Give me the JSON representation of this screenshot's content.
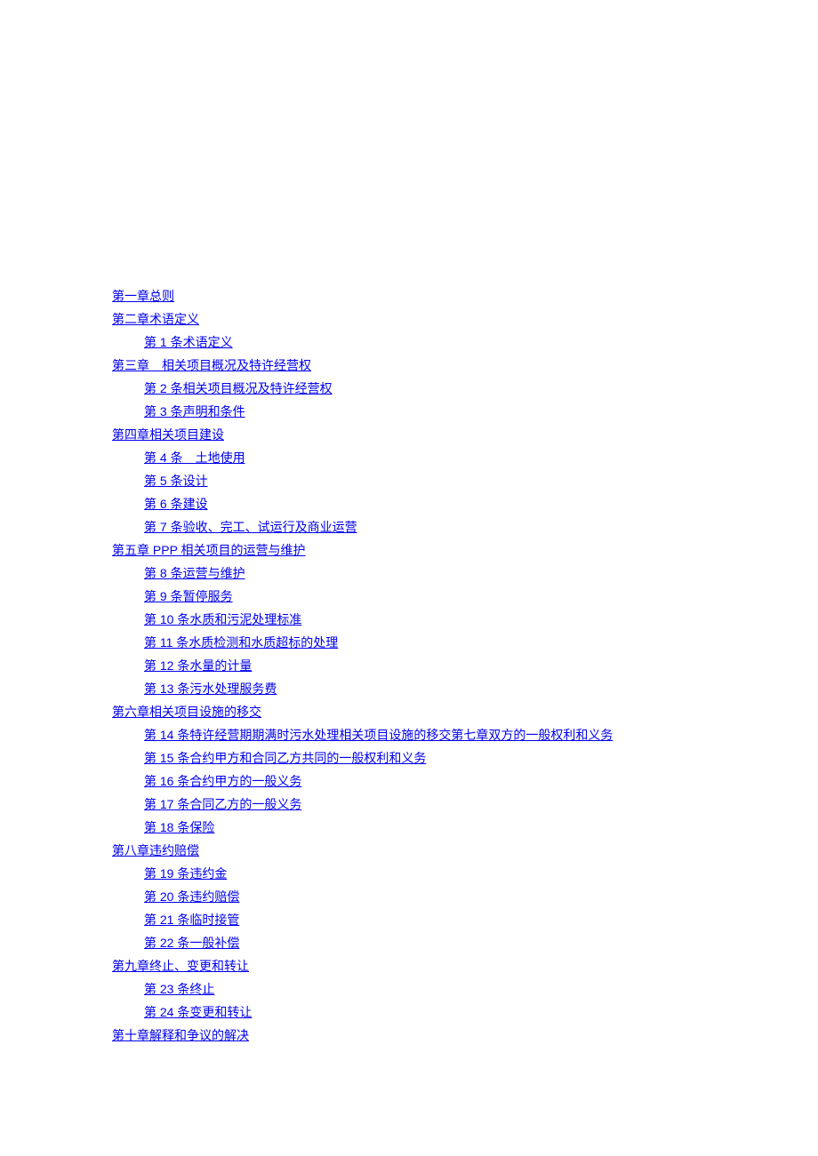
{
  "toc": [
    {
      "indent": 0,
      "label": "第一章总则"
    },
    {
      "indent": 0,
      "label": "第二章术语定义"
    },
    {
      "indent": 1,
      "label": "第 1 条术语定义"
    },
    {
      "indent": 0,
      "label": "第三章　相关项目概况及特许经营权"
    },
    {
      "indent": 1,
      "label": "第 2 条相关项目概况及特许经营权"
    },
    {
      "indent": 1,
      "label": "第 3 条声明和条件"
    },
    {
      "indent": 0,
      "label": "第四章相关项目建设"
    },
    {
      "indent": 1,
      "label": "第 4 条　土地使用"
    },
    {
      "indent": 1,
      "label": "第 5 条设计"
    },
    {
      "indent": 1,
      "label": "第 6 条建设"
    },
    {
      "indent": 1,
      "label": "第 7 条验收、完工、试运行及商业运营"
    },
    {
      "indent": 0,
      "label": "第五章 PPP 相关项目的运营与维护"
    },
    {
      "indent": 1,
      "label": "第 8 条运营与维护"
    },
    {
      "indent": 1,
      "label": "第 9 条暂停服务"
    },
    {
      "indent": 1,
      "label": "第 10 条水质和污泥处理标准"
    },
    {
      "indent": 1,
      "label": "第 11 条水质检测和水质超标的处理"
    },
    {
      "indent": 1,
      "label": "第 12 条水量的计量"
    },
    {
      "indent": 1,
      "label": "第 13 条污水处理服务费"
    },
    {
      "indent": 0,
      "label": "第六章相关项目设施的移交"
    },
    {
      "indent": 1,
      "label": "第 14 条特许经营期期满时污水处理相关项目设施的移交",
      "trailing": "第七章双方的一般权利和义务"
    },
    {
      "indent": 1,
      "label": "第 15 条合约甲方和合同乙方共同的一般权利和义务"
    },
    {
      "indent": 1,
      "label": "第 16 条合约甲方的一般义务"
    },
    {
      "indent": 1,
      "label": "第 17 条合同乙方的一般义务"
    },
    {
      "indent": 1,
      "label": "第 18 条保险"
    },
    {
      "indent": 0,
      "label": "第八章违约赔偿"
    },
    {
      "indent": 1,
      "label": "第 19 条违约金"
    },
    {
      "indent": 1,
      "label": "第 20 条违约赔偿"
    },
    {
      "indent": 1,
      "label": "第 21 条临时接管"
    },
    {
      "indent": 1,
      "label": "第 22 条一般补偿"
    },
    {
      "indent": 0,
      "label": "第九章终止、变更和转让"
    },
    {
      "indent": 1,
      "label": "第 23 条终止"
    },
    {
      "indent": 1,
      "label": "第 24 条变更和转让"
    },
    {
      "indent": 0,
      "label": "第十章解释和争议的解决"
    }
  ]
}
